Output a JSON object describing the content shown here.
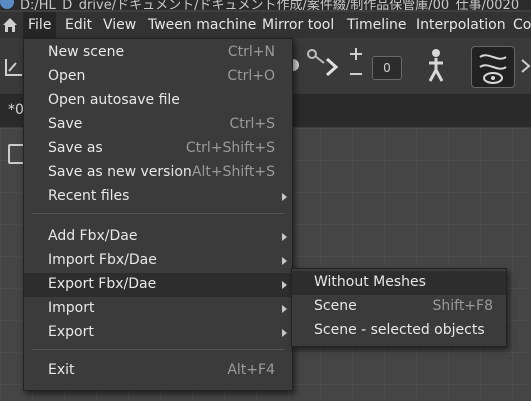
{
  "window": {
    "title": "D:/HL_D_drive/ドキュメント/ドキュメント作成/案件綴/制作品保管庫/00_仕事/0020"
  },
  "menubar": {
    "items": [
      {
        "label": "File"
      },
      {
        "label": "Edit"
      },
      {
        "label": "View"
      },
      {
        "label": "Tween machine"
      },
      {
        "label": "Mirror tool"
      },
      {
        "label": "Timeline"
      },
      {
        "label": "Interpolation"
      },
      {
        "label": "Co"
      }
    ]
  },
  "toolbar": {
    "stepper_value": "0"
  },
  "tab": {
    "label": "*0"
  },
  "file_menu": {
    "items": [
      {
        "label": "New scene",
        "shortcut": "Ctrl+N"
      },
      {
        "label": "Open",
        "shortcut": "Ctrl+O"
      },
      {
        "label": "Open autosave file",
        "shortcut": ""
      },
      {
        "label": "Save",
        "shortcut": "Ctrl+S"
      },
      {
        "label": "Save as",
        "shortcut": "Ctrl+Shift+S"
      },
      {
        "label": "Save as new version",
        "shortcut": "Alt+Shift+S"
      },
      {
        "label": "Recent files",
        "shortcut": ""
      },
      {
        "label": "Add Fbx/Dae",
        "shortcut": ""
      },
      {
        "label": "Import Fbx/Dae",
        "shortcut": ""
      },
      {
        "label": "Export Fbx/Dae",
        "shortcut": ""
      },
      {
        "label": "Import",
        "shortcut": ""
      },
      {
        "label": "Export",
        "shortcut": ""
      },
      {
        "label": "Exit",
        "shortcut": "Alt+F4"
      }
    ]
  },
  "export_submenu": {
    "items": [
      {
        "label": "Without Meshes",
        "shortcut": ""
      },
      {
        "label": "Scene",
        "shortcut": "Shift+F8"
      },
      {
        "label": "Scene - selected objects",
        "shortcut": ""
      }
    ]
  }
}
